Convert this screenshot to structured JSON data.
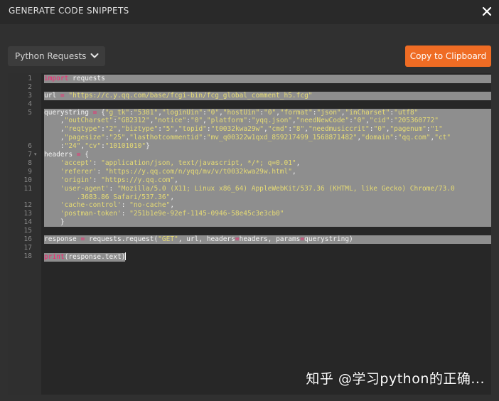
{
  "dialog": {
    "title": "GENERATE CODE SNIPPETS",
    "close_icon": "close-icon"
  },
  "toolbar": {
    "language_selected": "Python Requests",
    "copy_label": "Copy to Clipboard"
  },
  "colors": {
    "accent": "#ef6c24",
    "keyword": "#f92672",
    "string": "#e6db74",
    "selection": "#8e8e8e"
  },
  "editor": {
    "lines": [
      {
        "num": "1",
        "fold": "",
        "rows": 1,
        "sel": true,
        "tokens": [
          [
            "kw",
            "import"
          ],
          [
            "pl",
            " requests"
          ]
        ]
      },
      {
        "num": "2",
        "fold": "",
        "rows": 1,
        "sel": true,
        "tokens": []
      },
      {
        "num": "3",
        "fold": "",
        "rows": 1,
        "sel": true,
        "tokens": [
          [
            "pl",
            "url "
          ],
          [
            "op",
            "="
          ],
          [
            "pl",
            " "
          ],
          [
            "str",
            "\"https://c.y.qq.com/base/fcgi-bin/fcg_global_comment_h5.fcg\""
          ]
        ]
      },
      {
        "num": "4",
        "fold": "",
        "rows": 1,
        "sel": true,
        "tokens": []
      },
      {
        "num": "5",
        "fold": "",
        "rows": 4,
        "sel": true,
        "tokens": [
          [
            "pl",
            "querystring "
          ],
          [
            "op",
            "="
          ],
          [
            "pl",
            " {"
          ],
          [
            "str",
            "\"g_tk\""
          ],
          [
            "pl",
            ":"
          ],
          [
            "str",
            "\"5381\""
          ],
          [
            "pl",
            ","
          ],
          [
            "str",
            "\"loginUin\""
          ],
          [
            "pl",
            ":"
          ],
          [
            "str",
            "\"0\""
          ],
          [
            "pl",
            ","
          ],
          [
            "str",
            "\"hostUin\""
          ],
          [
            "pl",
            ":"
          ],
          [
            "str",
            "\"0\""
          ],
          [
            "pl",
            ","
          ],
          [
            "str",
            "\"format\""
          ],
          [
            "pl",
            ":"
          ],
          [
            "str",
            "\"json\""
          ],
          [
            "pl",
            ","
          ],
          [
            "str",
            "\"inCharset\""
          ],
          [
            "pl",
            ":"
          ],
          [
            "str",
            "\"utf8\""
          ],
          [
            "pl",
            "\n    ,"
          ],
          [
            "str",
            "\"outCharset\""
          ],
          [
            "pl",
            ":"
          ],
          [
            "str",
            "\"GB2312\""
          ],
          [
            "pl",
            ","
          ],
          [
            "str",
            "\"notice\""
          ],
          [
            "pl",
            ":"
          ],
          [
            "str",
            "\"0\""
          ],
          [
            "pl",
            ","
          ],
          [
            "str",
            "\"platform\""
          ],
          [
            "pl",
            ":"
          ],
          [
            "str",
            "\"yqq.json\""
          ],
          [
            "pl",
            ","
          ],
          [
            "str",
            "\"needNewCode\""
          ],
          [
            "pl",
            ":"
          ],
          [
            "str",
            "\"0\""
          ],
          [
            "pl",
            ","
          ],
          [
            "str",
            "\"cid\""
          ],
          [
            "pl",
            ":"
          ],
          [
            "str",
            "\"205360772\""
          ],
          [
            "pl",
            "\n    ,"
          ],
          [
            "str",
            "\"reqtype\""
          ],
          [
            "pl",
            ":"
          ],
          [
            "str",
            "\"2\""
          ],
          [
            "pl",
            ","
          ],
          [
            "str",
            "\"biztype\""
          ],
          [
            "pl",
            ":"
          ],
          [
            "str",
            "\"5\""
          ],
          [
            "pl",
            ","
          ],
          [
            "str",
            "\"topid\""
          ],
          [
            "pl",
            ":"
          ],
          [
            "str",
            "\"t0032kwa29w\""
          ],
          [
            "pl",
            ","
          ],
          [
            "str",
            "\"cmd\""
          ],
          [
            "pl",
            ":"
          ],
          [
            "str",
            "\"8\""
          ],
          [
            "pl",
            ","
          ],
          [
            "str",
            "\"needmusiccrit\""
          ],
          [
            "pl",
            ":"
          ],
          [
            "str",
            "\"0\""
          ],
          [
            "pl",
            ","
          ],
          [
            "str",
            "\"pagenum\""
          ],
          [
            "pl",
            ":"
          ],
          [
            "str",
            "\"1\""
          ],
          [
            "pl",
            "\n    ,"
          ],
          [
            "str",
            "\"pagesize\""
          ],
          [
            "pl",
            ":"
          ],
          [
            "str",
            "\"25\""
          ],
          [
            "pl",
            ","
          ],
          [
            "str",
            "\"lasthotcommentid\""
          ],
          [
            "pl",
            ":"
          ],
          [
            "str",
            "\"mv_q00322w1qxd_859217499_1568871482\""
          ],
          [
            "pl",
            ","
          ],
          [
            "str",
            "\"domain\""
          ],
          [
            "pl",
            ":"
          ],
          [
            "str",
            "\"qq.com\""
          ],
          [
            "pl",
            ","
          ],
          [
            "str",
            "\"ct\""
          ],
          [
            "pl",
            "\n    :"
          ],
          [
            "str",
            "\"24\""
          ],
          [
            "pl",
            ","
          ],
          [
            "str",
            "\"cv\""
          ],
          [
            "pl",
            ":"
          ],
          [
            "str",
            "\"10101010\""
          ],
          [
            "pl",
            "}"
          ]
        ]
      },
      {
        "num": "6",
        "fold": "",
        "rows": 1,
        "sel": true,
        "tokens": []
      },
      {
        "num": "7",
        "fold": "▾",
        "rows": 1,
        "sel": true,
        "tokens": [
          [
            "pl",
            "headers "
          ],
          [
            "op",
            "="
          ],
          [
            "pl",
            " {"
          ]
        ]
      },
      {
        "num": "8",
        "fold": "",
        "rows": 1,
        "sel": true,
        "tokens": [
          [
            "pl",
            "    "
          ],
          [
            "str",
            "'accept'"
          ],
          [
            "pl",
            ": "
          ],
          [
            "str",
            "\"application/json, text/javascript, */*; q=0.01\""
          ],
          [
            "pl",
            ","
          ]
        ]
      },
      {
        "num": "9",
        "fold": "",
        "rows": 1,
        "sel": true,
        "tokens": [
          [
            "pl",
            "    "
          ],
          [
            "str",
            "'referer'"
          ],
          [
            "pl",
            ": "
          ],
          [
            "str",
            "\"https://y.qq.com/n/yqq/mv/v/t0032kwa29w.html\""
          ],
          [
            "pl",
            ","
          ]
        ]
      },
      {
        "num": "10",
        "fold": "",
        "rows": 1,
        "sel": true,
        "tokens": [
          [
            "pl",
            "    "
          ],
          [
            "str",
            "'origin'"
          ],
          [
            "pl",
            ": "
          ],
          [
            "str",
            "\"https://y.qq.com\""
          ],
          [
            "pl",
            ","
          ]
        ]
      },
      {
        "num": "11",
        "fold": "",
        "rows": 2,
        "sel": true,
        "tokens": [
          [
            "pl",
            "    "
          ],
          [
            "str",
            "'user-agent'"
          ],
          [
            "pl",
            ": "
          ],
          [
            "str",
            "\"Mozilla/5.0 (X11; Linux x86_64) AppleWebKit/537.36 (KHTML, like Gecko) Chrome/73.0\n        .3683.86 Safari/537.36\""
          ],
          [
            "pl",
            ","
          ]
        ]
      },
      {
        "num": "12",
        "fold": "",
        "rows": 1,
        "sel": true,
        "tokens": [
          [
            "pl",
            "    "
          ],
          [
            "str",
            "'cache-control'"
          ],
          [
            "pl",
            ": "
          ],
          [
            "str",
            "\"no-cache\""
          ],
          [
            "pl",
            ","
          ]
        ]
      },
      {
        "num": "13",
        "fold": "",
        "rows": 1,
        "sel": true,
        "tokens": [
          [
            "pl",
            "    "
          ],
          [
            "str",
            "'postman-token'"
          ],
          [
            "pl",
            ": "
          ],
          [
            "str",
            "\"251b1e9e-92ef-1145-0946-58e45c3e3cb0\""
          ]
        ]
      },
      {
        "num": "14",
        "fold": "",
        "rows": 1,
        "sel": true,
        "tokens": [
          [
            "pl",
            "    }"
          ]
        ]
      },
      {
        "num": "15",
        "fold": "",
        "rows": 1,
        "sel": true,
        "tokens": []
      },
      {
        "num": "16",
        "fold": "",
        "rows": 1,
        "sel": true,
        "tokens": [
          [
            "pl",
            "response "
          ],
          [
            "op",
            "="
          ],
          [
            "pl",
            " requests.request("
          ],
          [
            "str",
            "\"GET\""
          ],
          [
            "pl",
            ", url, headers"
          ],
          [
            "op",
            "="
          ],
          [
            "pl",
            "headers, params"
          ],
          [
            "op",
            "="
          ],
          [
            "pl",
            "querystring)"
          ]
        ]
      },
      {
        "num": "17",
        "fold": "",
        "rows": 1,
        "sel": true,
        "tokens": []
      },
      {
        "num": "18",
        "fold": "",
        "rows": 1,
        "sel": "partial",
        "tokens": [
          [
            "kw",
            "print"
          ],
          [
            "pl",
            "(response.text)"
          ]
        ]
      }
    ]
  },
  "watermark": "知乎 @学习python的正确..."
}
